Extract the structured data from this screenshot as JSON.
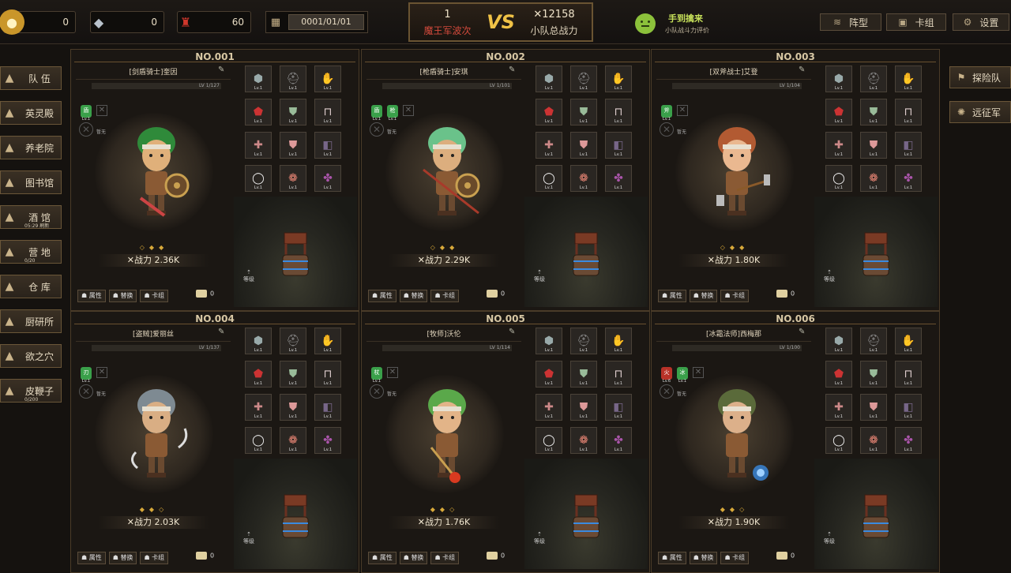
{
  "topbar": {
    "resources": [
      {
        "name": "gold",
        "icon": "coin-icon",
        "value": "0",
        "color": "#e8b53c"
      },
      {
        "name": "ore",
        "icon": "ore-icon",
        "value": "0",
        "color": "#9aa4b0"
      },
      {
        "name": "potion",
        "icon": "potion-icon",
        "value": "60",
        "color": "#c8342b"
      }
    ],
    "date": "0001/01/01",
    "vs": {
      "left_num": "1",
      "left_label": "魔王军波次",
      "vs_text": "VS",
      "right_num": "✕12158",
      "right_label": "小队总战力"
    },
    "checkin": {
      "title": "手到擒来",
      "subtitle": "小队战斗力评价"
    },
    "buttons": [
      {
        "label": "阵型",
        "icon": "formation-icon"
      },
      {
        "label": "卡组",
        "icon": "cards-icon"
      },
      {
        "label": "设置",
        "icon": "gear-icon"
      }
    ]
  },
  "sidebar": [
    {
      "label": "队 伍",
      "icon": "team-icon",
      "sub": ""
    },
    {
      "label": "英灵殿",
      "icon": "hall-icon",
      "sub": ""
    },
    {
      "label": "养老院",
      "icon": "house-icon",
      "sub": ""
    },
    {
      "label": "图书馆",
      "icon": "book-icon",
      "sub": ""
    },
    {
      "label": "酒 馆",
      "icon": "barrel-icon",
      "sub": "05:29 刷新"
    },
    {
      "label": "营 地",
      "icon": "tent-icon",
      "sub": "0/20"
    },
    {
      "label": "仓 库",
      "icon": "warehouse-icon",
      "sub": ""
    },
    {
      "label": "厨研所",
      "icon": "bulb-icon",
      "sub": ""
    },
    {
      "label": "欲之穴",
      "icon": "cave-icon",
      "sub": ""
    },
    {
      "label": "皮鞭子",
      "icon": "whip-icon",
      "sub": "0/200"
    }
  ],
  "right_buttons": [
    {
      "label": "探险队",
      "icon": "flag-icon"
    },
    {
      "label": "远征军",
      "icon": "compass-icon"
    }
  ],
  "cards": [
    {
      "no": "NO.001",
      "name": "[剑盾骑士]奎因",
      "lv": "LV 1/127",
      "power": "✕战力 2.36K",
      "stars": "◇◆◆",
      "hair": "#2f8a3a",
      "skin": "#e0b07a",
      "weapon": "shield",
      "skills": [
        {
          "txt": "盾",
          "lv": "Lv.1",
          "color": "#3aa04a"
        }
      ],
      "chest": "0"
    },
    {
      "no": "NO.002",
      "name": "[枪盾骑士]安琪",
      "lv": "LV 1/101",
      "power": "✕战力 2.29K",
      "stars": "◇◆◆",
      "hair": "#6ac28a",
      "skin": "#dcae7e",
      "weapon": "spear",
      "skills": [
        {
          "txt": "盾",
          "lv": "Lv.1",
          "color": "#3aa04a"
        },
        {
          "txt": "枪",
          "lv": "Lv.1",
          "color": "#3aa04a"
        }
      ],
      "chest": "0"
    },
    {
      "no": "NO.003",
      "name": "[双斧战士]艾登",
      "lv": "LV 1/104",
      "power": "✕战力 1.80K",
      "stars": "◇◆◆",
      "hair": "#b25a32",
      "skin": "#eab890",
      "weapon": "axe",
      "skills": [
        {
          "txt": "斧",
          "lv": "Lv.1",
          "color": "#3aa04a"
        }
      ],
      "chest": "0"
    },
    {
      "no": "NO.004",
      "name": "[盗贼]爱丽丝",
      "lv": "LV 1/137",
      "power": "✕战力 2.03K",
      "stars": "◆◆◇",
      "hair": "#7e8a92",
      "skin": "#d9ae84",
      "weapon": "dagger",
      "skills": [
        {
          "txt": "刃",
          "lv": "Lv.1",
          "color": "#3aa04a"
        }
      ],
      "chest": "0"
    },
    {
      "no": "NO.005",
      "name": "[牧师]沃伦",
      "lv": "LV 1/114",
      "power": "✕战力 1.76K",
      "stars": "◆◆◇",
      "hair": "#5aa84a",
      "skin": "#e2b488",
      "weapon": "staff",
      "skills": [
        {
          "txt": "杖",
          "lv": "Lv.1",
          "color": "#3aa04a"
        }
      ],
      "chest": "0"
    },
    {
      "no": "NO.006",
      "name": "[冰霜法师]西梅那",
      "lv": "LV 1/100",
      "power": "✕战力 1.90K",
      "stars": "◆◆◇",
      "hair": "#5a6a3a",
      "skin": "#dcb08a",
      "weapon": "frost",
      "skills": [
        {
          "txt": "火",
          "lv": "Lv.6",
          "color": "#b83228"
        },
        {
          "txt": "冰",
          "lv": "Lv.1",
          "color": "#3aa04a"
        }
      ],
      "chest": "0"
    }
  ],
  "card_labels": {
    "leave": "暂无",
    "attr": "属性",
    "swap": "替换",
    "deck": "卡组",
    "rank": "等级"
  },
  "equip_slot_lv": "Lv.1"
}
